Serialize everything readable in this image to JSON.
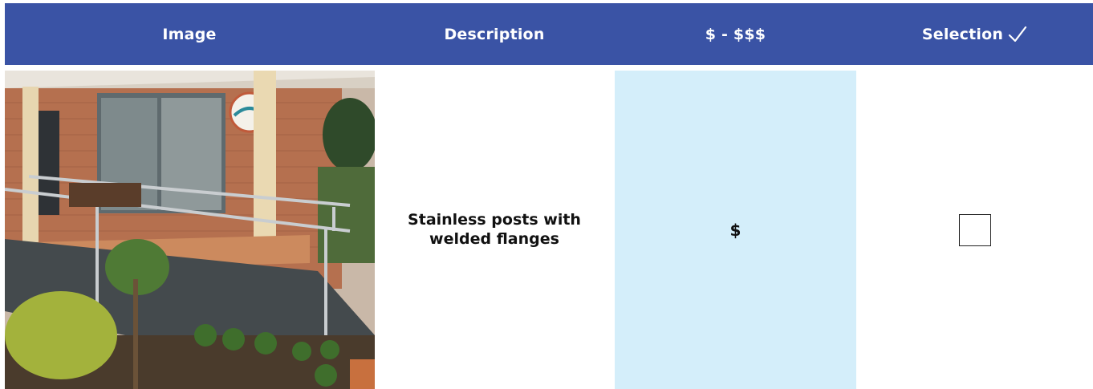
{
  "table": {
    "headers": {
      "image": "Image",
      "description": "Description",
      "cost": "$ - $$$",
      "selection": "Selection"
    },
    "rows": [
      {
        "description": "Stainless posts with welded flanges",
        "cost": "$",
        "selected": false
      }
    ]
  },
  "colors": {
    "header_bg": "#3a53a5",
    "cost_bg": "#d4eefa"
  },
  "icons": [
    "check-mark-icon",
    "checkbox-icon"
  ]
}
